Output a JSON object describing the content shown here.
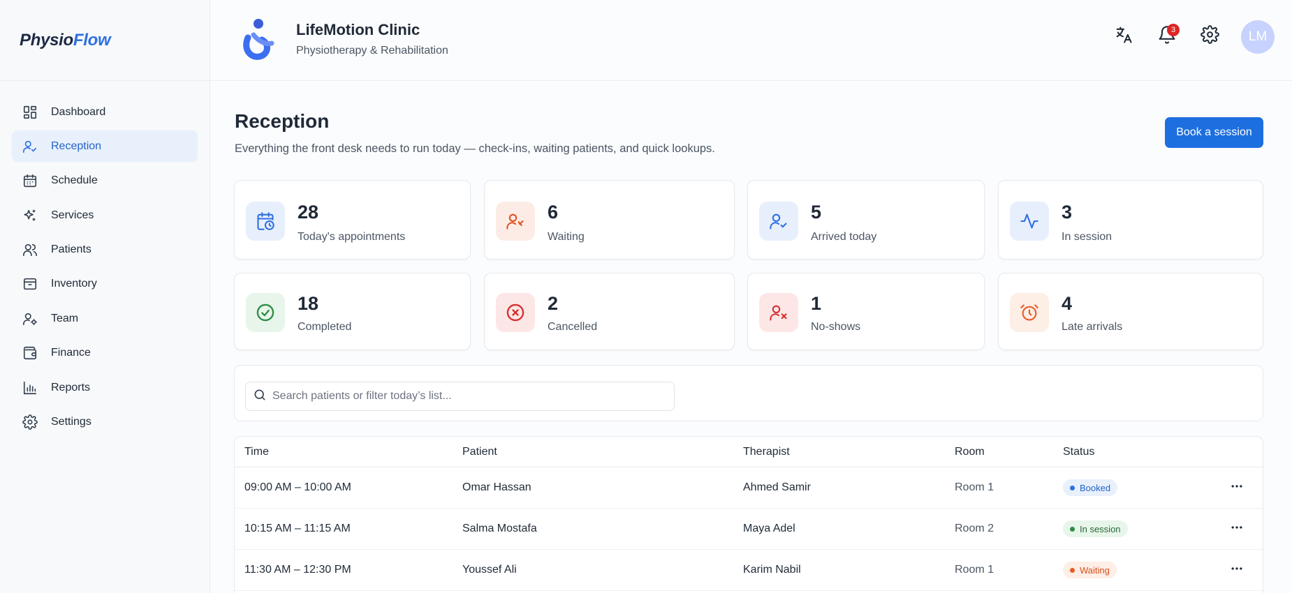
{
  "brand": {
    "part1": "Physio",
    "part2": "Flow"
  },
  "sidebar": {
    "items": [
      {
        "label": "Dashboard",
        "icon": "dashboard-icon"
      },
      {
        "label": "Reception",
        "icon": "user-check-icon",
        "active": true
      },
      {
        "label": "Schedule",
        "icon": "calendar-icon"
      },
      {
        "label": "Services",
        "icon": "sparkles-icon"
      },
      {
        "label": "Patients",
        "icon": "users-icon"
      },
      {
        "label": "Inventory",
        "icon": "archive-icon"
      },
      {
        "label": "Team",
        "icon": "user-cog-icon"
      },
      {
        "label": "Finance",
        "icon": "wallet-icon"
      },
      {
        "label": "Reports",
        "icon": "bar-chart-icon"
      },
      {
        "label": "Settings",
        "icon": "gear-icon"
      }
    ]
  },
  "header": {
    "clinic_name": "LifeMotion Clinic",
    "clinic_subtitle": "Physiotherapy & Rehabilitation",
    "notifications_count": "3",
    "avatar_initials": "LM"
  },
  "page": {
    "title": "Reception",
    "description": "Everything the front desk needs to run today — check-ins, waiting patients, and quick lookups.",
    "book_button": "Book a session"
  },
  "stats": [
    {
      "value": "28",
      "label": "Today's appointments",
      "icon": "calendar-clock-icon",
      "tone": "blue"
    },
    {
      "value": "6",
      "label": "Waiting",
      "icon": "user-waiting-icon",
      "tone": "orange"
    },
    {
      "value": "5",
      "label": "Arrived today",
      "icon": "user-check-icon",
      "tone": "blue"
    },
    {
      "value": "3",
      "label": "In session",
      "icon": "activity-icon",
      "tone": "blue"
    },
    {
      "value": "18",
      "label": "Completed",
      "icon": "check-circle-icon",
      "tone": "green"
    },
    {
      "value": "2",
      "label": "Cancelled",
      "icon": "x-circle-icon",
      "tone": "red"
    },
    {
      "value": "1",
      "label": "No-shows",
      "icon": "user-x-icon",
      "tone": "red"
    },
    {
      "value": "4",
      "label": "Late arrivals",
      "icon": "alarm-clock-icon",
      "tone": "peach"
    }
  ],
  "search": {
    "placeholder": "Search patients or filter today’s list..."
  },
  "table": {
    "headers": {
      "time": "Time",
      "patient": "Patient",
      "therapist": "Therapist",
      "room": "Room",
      "status": "Status"
    },
    "rows": [
      {
        "time": "09:00 AM – 10:00 AM",
        "patient": "Omar Hassan",
        "therapist": "Ahmed Samir",
        "room": "Room 1",
        "status": "Booked"
      },
      {
        "time": "10:15 AM – 11:15 AM",
        "patient": "Salma Mostafa",
        "therapist": "Maya Adel",
        "room": "Room 2",
        "status": "In session"
      },
      {
        "time": "11:30 AM – 12:30 PM",
        "patient": "Youssef Ali",
        "therapist": "Karim Nabil",
        "room": "Room 1",
        "status": "Waiting"
      }
    ]
  },
  "colors": {
    "accent": "#1d6fe0",
    "status_booked": "#2f6fe0",
    "status_in_session": "#2e8b45",
    "status_waiting": "#ea5a23",
    "badge": "#dc2626"
  }
}
